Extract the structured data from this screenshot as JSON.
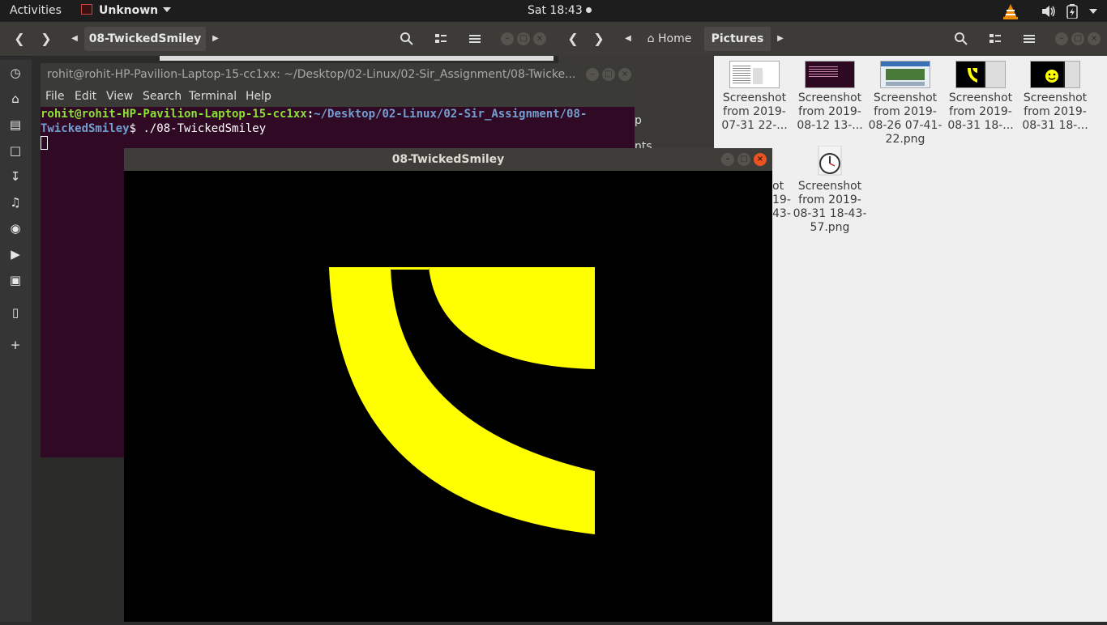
{
  "topbar": {
    "activities": "Activities",
    "app_name": "Unknown",
    "clock": "Sat 18:43"
  },
  "dock": {
    "items": [
      "recent-icon",
      "home-icon",
      "files-icon",
      "documents-icon",
      "downloads-icon",
      "music-icon",
      "camera-icon",
      "videos-icon",
      "trash-icon",
      "drive-icon",
      "add-location-icon"
    ]
  },
  "left_fm": {
    "path_button": "08-TwickedSmiley"
  },
  "right_fm": {
    "path_home": "Home",
    "path_pictures": "Pictures",
    "sidebar_partial": [
      "p",
      "nts"
    ],
    "files": [
      {
        "line1": "Screenshot",
        "line2": "from 2019-",
        "line3": "07-31 22-...",
        "line4": ""
      },
      {
        "line1": "Screenshot",
        "line2": "from 2019-",
        "line3": "08-12 13-...",
        "line4": ""
      },
      {
        "line1": "Screenshot",
        "line2": "from 2019-",
        "line3": "08-26 07-41-",
        "line4": "22.png"
      },
      {
        "line1": "Screenshot",
        "line2": "from 2019-",
        "line3": "08-31 18-...",
        "line4": ""
      },
      {
        "line1": "Screenshot",
        "line2": "from 2019-",
        "line3": "08-31 18-...",
        "line4": ""
      },
      {
        "line1": "ot",
        "line2": "19-",
        "line3": "43-",
        "line4": ""
      },
      {
        "line1": "Screenshot",
        "line2": "from 2019-",
        "line3": "08-31 18-43-",
        "line4": "57.png"
      }
    ]
  },
  "terminal": {
    "title": "rohit@rohit-HP-Pavilion-Laptop-15-cc1xx: ~/Desktop/02-Linux/02-Sir_Assignment/08-Twicke...",
    "menu": [
      "File",
      "Edit",
      "View",
      "Search",
      "Terminal",
      "Help"
    ],
    "prompt_user": "rohit@rohit-HP-Pavilion-Laptop-15-cc1xx",
    "prompt_sep": ":",
    "prompt_path1": "~/Desktop/02-Linux/02-Sir_Assignment/08-",
    "prompt_path2": "TwickedSmiley",
    "prompt_end": "$ ",
    "command": "./08-TwickedSmiley"
  },
  "glwindow": {
    "title": "08-TwickedSmiley",
    "fill_color": "#ffff00",
    "bg_color": "#000000"
  },
  "colors": {
    "topbar": "#1d1d1d",
    "terminal_bg": "#300a24",
    "accent_close": "#e95420"
  }
}
